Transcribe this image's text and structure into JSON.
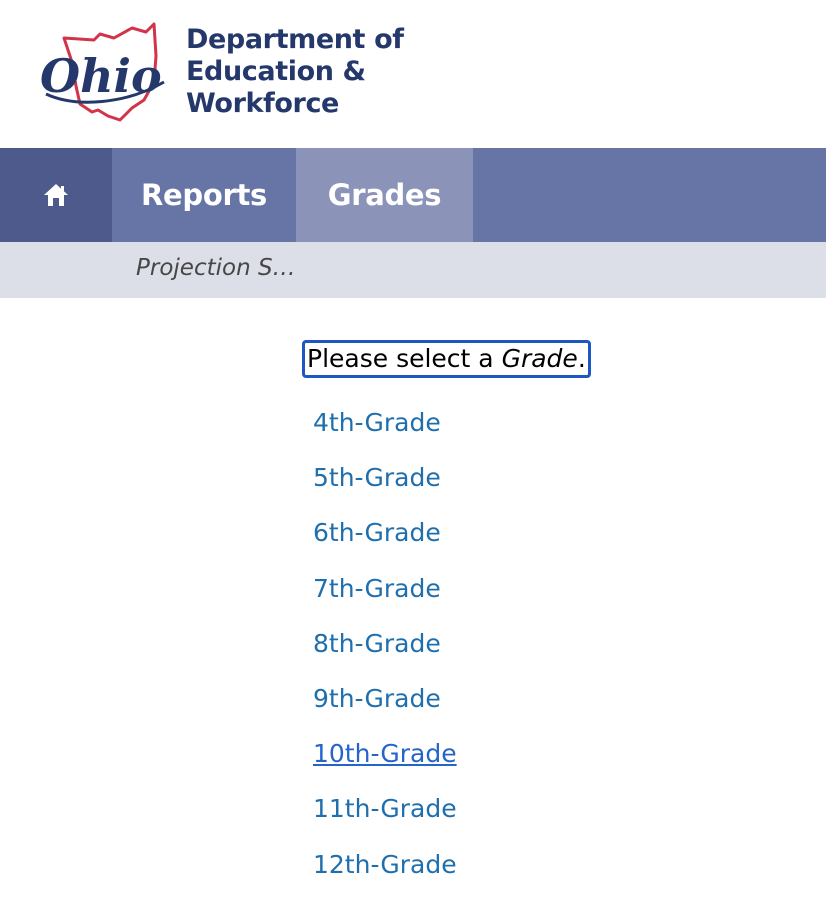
{
  "header": {
    "logo_text": "Ohio",
    "org_lines": [
      "Department of",
      "Education &",
      "Workforce"
    ]
  },
  "nav": {
    "home_icon": "home-icon",
    "tabs": [
      {
        "label": "Reports"
      },
      {
        "label": "Grades",
        "active": true
      }
    ]
  },
  "breadcrumb": {
    "current": "Projection S…"
  },
  "prompt": {
    "prefix": "Please select a ",
    "emphasis": "Grade",
    "suffix": "."
  },
  "grades": [
    {
      "label": "4th-Grade"
    },
    {
      "label": "5th-Grade"
    },
    {
      "label": "6th-Grade"
    },
    {
      "label": "7th-Grade"
    },
    {
      "label": "8th-Grade"
    },
    {
      "label": "9th-Grade"
    },
    {
      "label": "10th-Grade",
      "active": true
    },
    {
      "label": "11th-Grade"
    },
    {
      "label": "12th-Grade"
    }
  ],
  "colors": {
    "brand_navy": "#25386b",
    "brand_red": "#d2344a",
    "nav_bg": "#6674a6",
    "nav_home_bg": "#4e5a8c",
    "nav_active_bg": "#8b93b9",
    "breadcrumb_bg": "#dcdfe8",
    "link": "#1f6fae",
    "focus_outline": "#1d57c4"
  }
}
